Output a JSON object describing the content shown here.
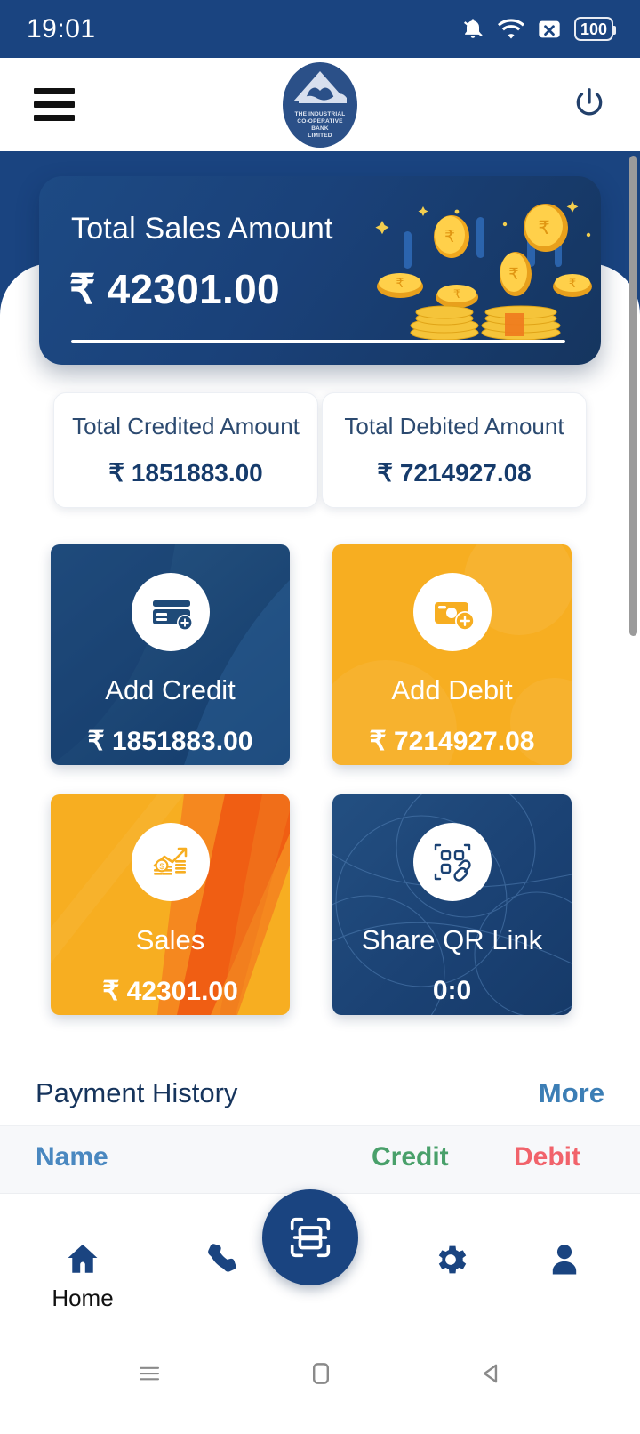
{
  "status_bar": {
    "time": "19:01",
    "battery": "100",
    "icons": [
      "bell-muted-icon",
      "wifi-icon",
      "sim-no-signal-icon",
      "battery-icon"
    ]
  },
  "app_bar": {
    "menu_icon": "hamburger-menu-icon",
    "power_icon": "power-icon",
    "logo": {
      "name": "bank-logo",
      "line1": "THE INDUSTRIAL",
      "line2": "CO-OPERATIVE",
      "line3": "BANK",
      "line4": "LIMITED"
    }
  },
  "sales_card": {
    "title": "Total Sales Amount",
    "amount": "₹ 42301.00",
    "illustration": "falling-coins-illustration"
  },
  "summary": [
    {
      "label": "Total Credited Amount",
      "value": "₹ 1851883.00"
    },
    {
      "label": "Total Debited Amount",
      "value": "₹ 7214927.08"
    }
  ],
  "tiles": [
    {
      "label": "Add Credit",
      "value": "₹ 1851883.00",
      "icon": "credit-card-plus-icon",
      "color": "#1f4a78"
    },
    {
      "label": "Add Debit",
      "value": "₹ 7214927.08",
      "icon": "cash-plus-icon",
      "color": "#F7AE21"
    },
    {
      "label": "Sales",
      "value": "₹ 42301.00",
      "icon": "growth-chart-coins-icon",
      "color": "#F7AE21"
    },
    {
      "label": "Share QR Link",
      "value": "0:0",
      "icon": "qr-link-icon",
      "color": "#1b4274"
    }
  ],
  "payment_history": {
    "title": "Payment History",
    "more": "More",
    "columns": [
      {
        "label": "Name",
        "color": "#4a88c0"
      },
      {
        "label": "Credit",
        "color": "#49a06a"
      },
      {
        "label": "Debit",
        "color": "#f1636b"
      }
    ],
    "rows": []
  },
  "bottom_nav": {
    "items": [
      {
        "label": "Home",
        "icon": "home-icon"
      },
      {
        "label": "",
        "icon": "phone-icon"
      },
      {
        "label": "",
        "icon": "settings-gear-icon"
      },
      {
        "label": "",
        "icon": "profile-person-icon"
      }
    ],
    "fab_icon": "scan-frame-icon"
  },
  "system_nav": {
    "recents_icon": "recents-icon",
    "home_icon": "home-square-icon",
    "back_icon": "back-triangle-icon"
  },
  "theme": {
    "primary_blue": "#1A4480",
    "accent_orange": "#F7AE21",
    "credit_green": "#49a06a",
    "debit_red": "#f1636b",
    "link_blue": "#3C7EB5"
  }
}
